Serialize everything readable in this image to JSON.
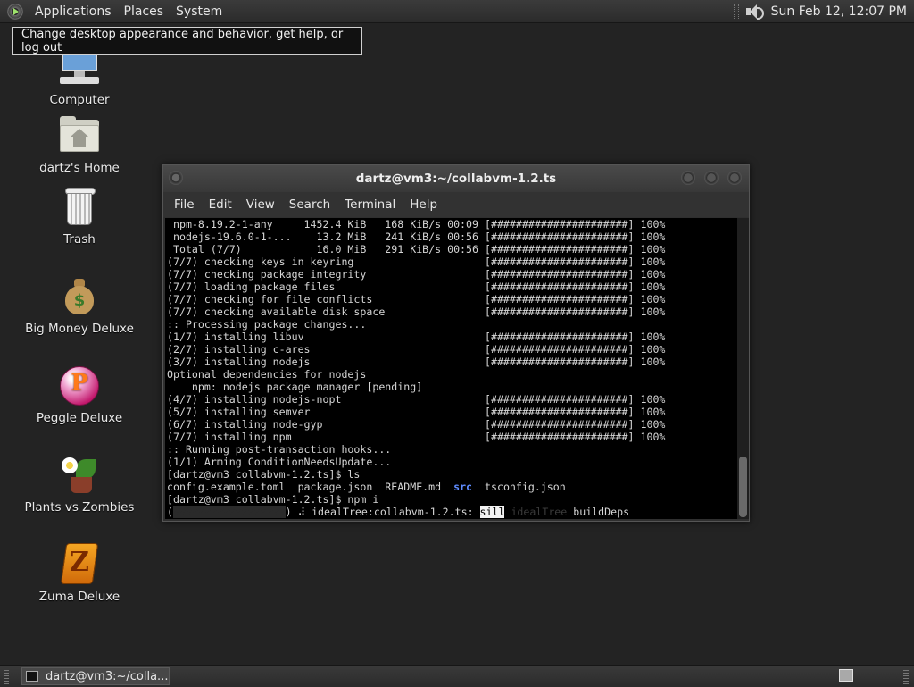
{
  "top_panel": {
    "menus": [
      "Applications",
      "Places",
      "System"
    ],
    "clock": "Sun Feb 12, 12:07 PM"
  },
  "tooltip": "Change desktop appearance and behavior, get help, or log out",
  "desktop_icons": [
    {
      "label": "Computer",
      "icon": "computer-icon"
    },
    {
      "label": "dartz's Home",
      "icon": "home-folder-icon"
    },
    {
      "label": "Trash",
      "icon": "trash-icon"
    },
    {
      "label": "Big Money Deluxe",
      "icon": "money-bag-icon"
    },
    {
      "label": "Peggle Deluxe",
      "icon": "peggle-icon"
    },
    {
      "label": "Plants vs Zombies",
      "icon": "plants-vs-zombies-icon"
    },
    {
      "label": "Zuma Deluxe",
      "icon": "zuma-icon"
    }
  ],
  "terminal": {
    "title": "dartz@vm3:~/collabvm-1.2.ts",
    "menu": [
      "File",
      "Edit",
      "View",
      "Search",
      "Terminal",
      "Help"
    ],
    "lines": [
      " npm-8.19.2-1-any     1452.4 KiB   168 KiB/s 00:09 [######################] 100%",
      " nodejs-19.6.0-1-...    13.2 MiB   241 KiB/s 00:56 [######################] 100%",
      " Total (7/7)            16.0 MiB   291 KiB/s 00:56 [######################] 100%",
      "(7/7) checking keys in keyring                     [######################] 100%",
      "(7/7) checking package integrity                   [######################] 100%",
      "(7/7) loading package files                        [######################] 100%",
      "(7/7) checking for file conflicts                  [######################] 100%",
      "(7/7) checking available disk space                [######################] 100%",
      ":: Processing package changes...",
      "(1/7) installing libuv                             [######################] 100%",
      "(2/7) installing c-ares                            [######################] 100%",
      "(3/7) installing nodejs                            [######################] 100%",
      "Optional dependencies for nodejs",
      "    npm: nodejs package manager [pending]",
      "(4/7) installing nodejs-nopt                       [######################] 100%",
      "(5/7) installing semver                            [######################] 100%",
      "(6/7) installing node-gyp                          [######################] 100%",
      "(7/7) installing npm                               [######################] 100%",
      ":: Running post-transaction hooks...",
      "(1/1) Arming ConditionNeedsUpdate...",
      "[dartz@vm3 collabvm-1.2.ts]$ ls"
    ],
    "ls_output": {
      "before": "config.example.toml  package.json  README.md  ",
      "src": "src",
      "after": "  tsconfig.json"
    },
    "npm_cmd_line": "[dartz@vm3 collabvm-1.2.ts]$ npm i",
    "progress_line": {
      "open": "(",
      "bar": "##################",
      "close": ") ",
      "spinner": "⠼",
      "text": " idealTree:collabvm-1.2.ts: ",
      "sill": "sill",
      "dim": " idealTree",
      "end": " buildDeps"
    }
  },
  "taskbar": {
    "task_label": "dartz@vm3:~/colla..."
  }
}
